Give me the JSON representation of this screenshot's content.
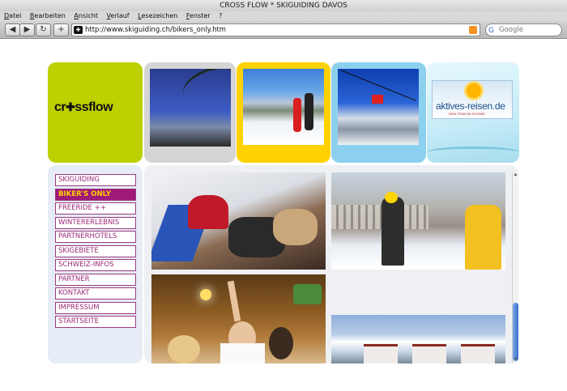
{
  "window": {
    "title": "CROSS FLOW * SKIGUIDING DAVOS"
  },
  "menubar": [
    "Datei",
    "Bearbeiten",
    "Ansicht",
    "Verlauf",
    "Lesezeichen",
    "Fenster",
    "?"
  ],
  "toolbar": {
    "back_icon": "◀",
    "forward_icon": "▶",
    "reload_icon": "↻",
    "new_tab_icon": "+",
    "url": "http://www.skiguiding.ch/bikers_only.htm",
    "search_placeholder": "Google",
    "search_engine_icon": "G"
  },
  "header": {
    "logo_prefix": "cr",
    "logo_cross": "✚",
    "logo_suffix": "ssflow",
    "ad_text": "aktives-reisen.de",
    "ad_subtext": "DEIN TEAM IM SCHNEE"
  },
  "sidebar": {
    "items": [
      {
        "label": "SKIGUIDING",
        "active": false
      },
      {
        "label": "BIKER'S ONLY",
        "active": true
      },
      {
        "label": "FREERIDE ++",
        "active": false
      },
      {
        "label": "WINTERERLEBNIS",
        "active": false
      },
      {
        "label": "PARTNERHOTELS",
        "active": false
      },
      {
        "label": "SKIGEBIETE",
        "active": false
      },
      {
        "label": "SCHWEIZ-INFOS",
        "active": false
      },
      {
        "label": "PARTNER",
        "active": false
      },
      {
        "label": "KONTAKT",
        "active": false
      },
      {
        "label": "IMPRESSUM",
        "active": false
      },
      {
        "label": "STARTSEITE",
        "active": false
      }
    ]
  },
  "colors": {
    "logo_tile": "#bdd000",
    "active_menu_bg": "#a01a79",
    "active_menu_text": "#ffd200",
    "menu_text": "#9a2a78"
  }
}
